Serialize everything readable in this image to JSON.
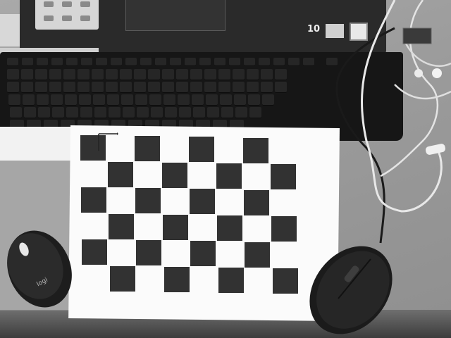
{
  "scene": {
    "objects": [
      "laptop",
      "keyboard",
      "checkerboard",
      "left-mouse",
      "right-mouse",
      "earphone-cable"
    ]
  },
  "laptop": {
    "sticker_text": "10"
  },
  "left_mouse": {
    "logo_text": "logi"
  },
  "checkerboard": {
    "rows": 6,
    "cols": 8
  }
}
